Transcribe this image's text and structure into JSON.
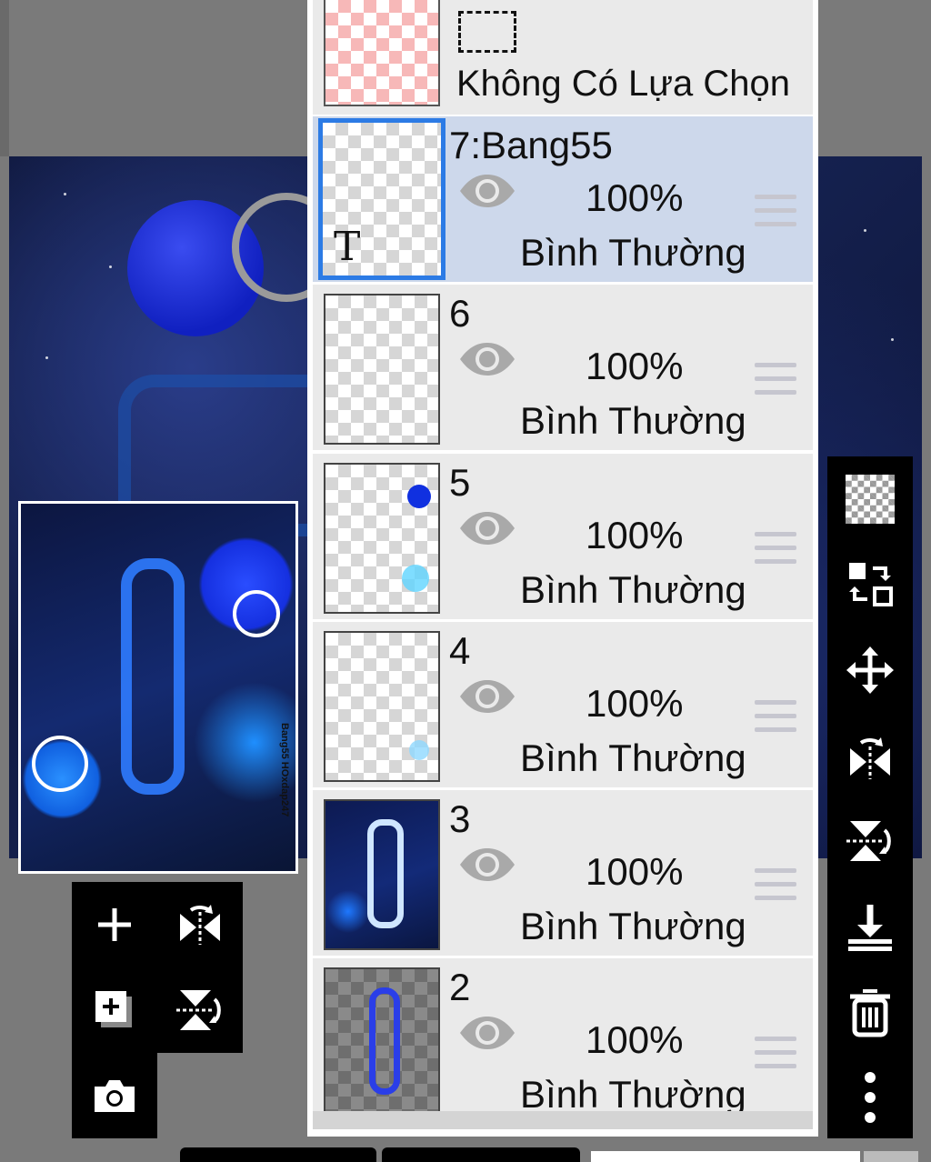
{
  "selection": {
    "label": "Không Có Lựa Chọn"
  },
  "layers": [
    {
      "name": "7:Bang55",
      "opacity": "100%",
      "blend": "Bình Thường",
      "selected": true
    },
    {
      "name": "6",
      "opacity": "100%",
      "blend": "Bình Thường",
      "selected": false
    },
    {
      "name": "5",
      "opacity": "100%",
      "blend": "Bình Thường",
      "selected": false
    },
    {
      "name": "4",
      "opacity": "100%",
      "blend": "Bình Thường",
      "selected": false
    },
    {
      "name": "3",
      "opacity": "100%",
      "blend": "Bình Thường",
      "selected": false
    },
    {
      "name": "2",
      "opacity": "100%",
      "blend": "Bình Thường",
      "selected": false
    }
  ],
  "navigator": {
    "signature": "Bang55 HOxdap247"
  },
  "left_tools": [
    "add-layer-icon",
    "flip-horizontal-icon",
    "add-layer-copy-icon",
    "flip-vertical-icon",
    "camera-icon"
  ],
  "right_tools": [
    "transparent-icon",
    "layer-order-icon",
    "move-icon",
    "flip-horizontal-icon",
    "flip-vertical-icon",
    "merge-down-icon",
    "delete-icon",
    "more-icon"
  ],
  "colors": {
    "selected_row": "#cdd8eb",
    "selected_border": "#2c7be5",
    "row": "#eaeaea",
    "toolbar": "#000000"
  }
}
